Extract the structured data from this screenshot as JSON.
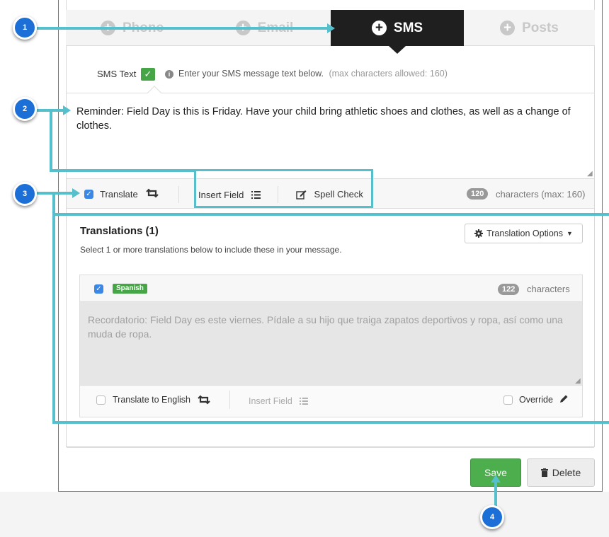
{
  "tabs": [
    {
      "label": "Phone",
      "active": false
    },
    {
      "label": "Email",
      "active": false
    },
    {
      "label": "SMS",
      "active": true
    },
    {
      "label": "Posts",
      "active": false
    }
  ],
  "sms_header": {
    "label": "SMS Text",
    "hint": "Enter your SMS message text below.",
    "max_note": "(max characters allowed: 160)"
  },
  "message": {
    "text": "Reminder: Field Day is this is Friday. Have your child bring athletic shoes and clothes, as well as a change of clothes."
  },
  "toolbar": {
    "translate_label": "Translate",
    "translate_checked": true,
    "insert_field_label": "Insert Field",
    "spell_check_label": "Spell Check",
    "char_count": "120",
    "char_suffix": "characters (max: 160)"
  },
  "translations": {
    "title": "Translations (1)",
    "subtitle": "Select 1 or more translations below to include these in your message.",
    "options_label": "Translation Options",
    "items": [
      {
        "language": "Spanish",
        "checked": true,
        "char_count": "122",
        "char_suffix": "characters",
        "text": "Recordatorio: Field Day es este viernes. Pídale a su hijo que traiga zapatos deportivos y ropa, así como una muda de ropa.",
        "translate_to_english_label": "Translate to English",
        "insert_field_label": "Insert Field",
        "override_label": "Override"
      }
    ]
  },
  "actions": {
    "save_label": "Save",
    "delete_label": "Delete"
  },
  "callouts": [
    "1",
    "2",
    "3",
    "4"
  ],
  "colors": {
    "active_tab": "#1f1f1f",
    "save_green": "#4cae4c",
    "callout_blue": "#1c6fd6",
    "annotation_teal": "#55bfcb",
    "checkbox_blue": "#3a87e6"
  }
}
